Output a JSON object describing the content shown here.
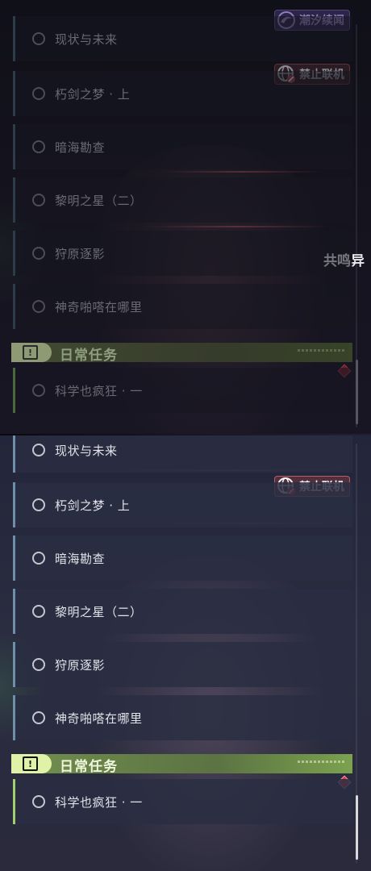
{
  "tasks": [
    {
      "label": "现状与未来"
    },
    {
      "label": "朽剑之梦 · 上"
    },
    {
      "label": "暗海勘查"
    },
    {
      "label": "黎明之星（二）"
    },
    {
      "label": "狩原逐影"
    },
    {
      "label": "神奇啪嗒在哪里"
    }
  ],
  "section": {
    "title": "日常任务",
    "icon_glyph": "!"
  },
  "daily_task": {
    "label": "科学也疯狂 · 一"
  },
  "badges": {
    "tide": "潮汐续闻",
    "no_link": "禁止联机"
  },
  "side_text": "共鸣异",
  "colors": {
    "accent_green": "#9ed06e",
    "task_bar_blue": "#6f8fa8",
    "pin_red": "#c83a4a",
    "badge_purple": "#8e7fb8"
  },
  "icons": {
    "task_status": "radio-ring-icon",
    "section": "exclamation-box-icon",
    "tide": "tide-swirl-icon",
    "no_link": "no-multiplayer-globe-icon",
    "pin": "diamond-pin-icon"
  }
}
